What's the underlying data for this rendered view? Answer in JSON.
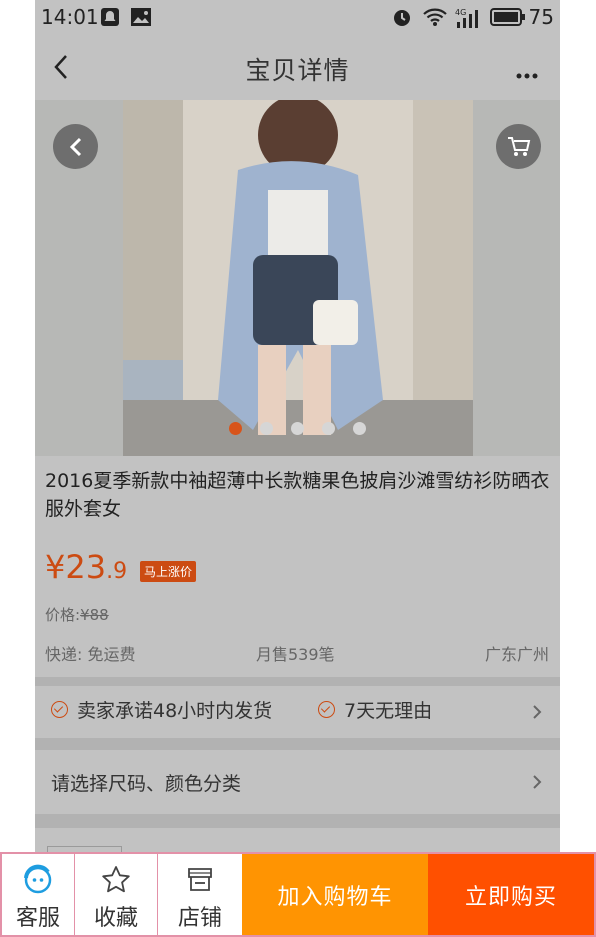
{
  "status_bar": {
    "time": "14:01",
    "battery": "75"
  },
  "nav": {
    "title": "宝贝详情"
  },
  "gallery": {
    "image_count": 5,
    "active_index": 0
  },
  "product": {
    "title": "2016夏季新款中袖超薄中长款糖果色披肩沙滩雪纺衫防晒衣服外套女",
    "price_symbol": "¥",
    "price_int": "23",
    "price_dec": ".9",
    "badge": "马上涨价",
    "original_price_label": "价格:",
    "original_price": "¥88",
    "shipping": "快递: 免运费",
    "monthly_sales": "月售539笔",
    "location": "广东广州"
  },
  "promises": [
    "卖家承诺48小时内发货",
    "7天无理由"
  ],
  "sku_selector": {
    "label": "请选择尺码、颜色分类"
  },
  "bottom_bar": {
    "customer_service": "客服",
    "favorite": "收藏",
    "shop": "店铺",
    "add_to_cart": "加入购物车",
    "buy_now": "立即购买"
  },
  "colors": {
    "accent": "#ff5000",
    "cart": "#ff9402",
    "price": "#cc4b12"
  }
}
